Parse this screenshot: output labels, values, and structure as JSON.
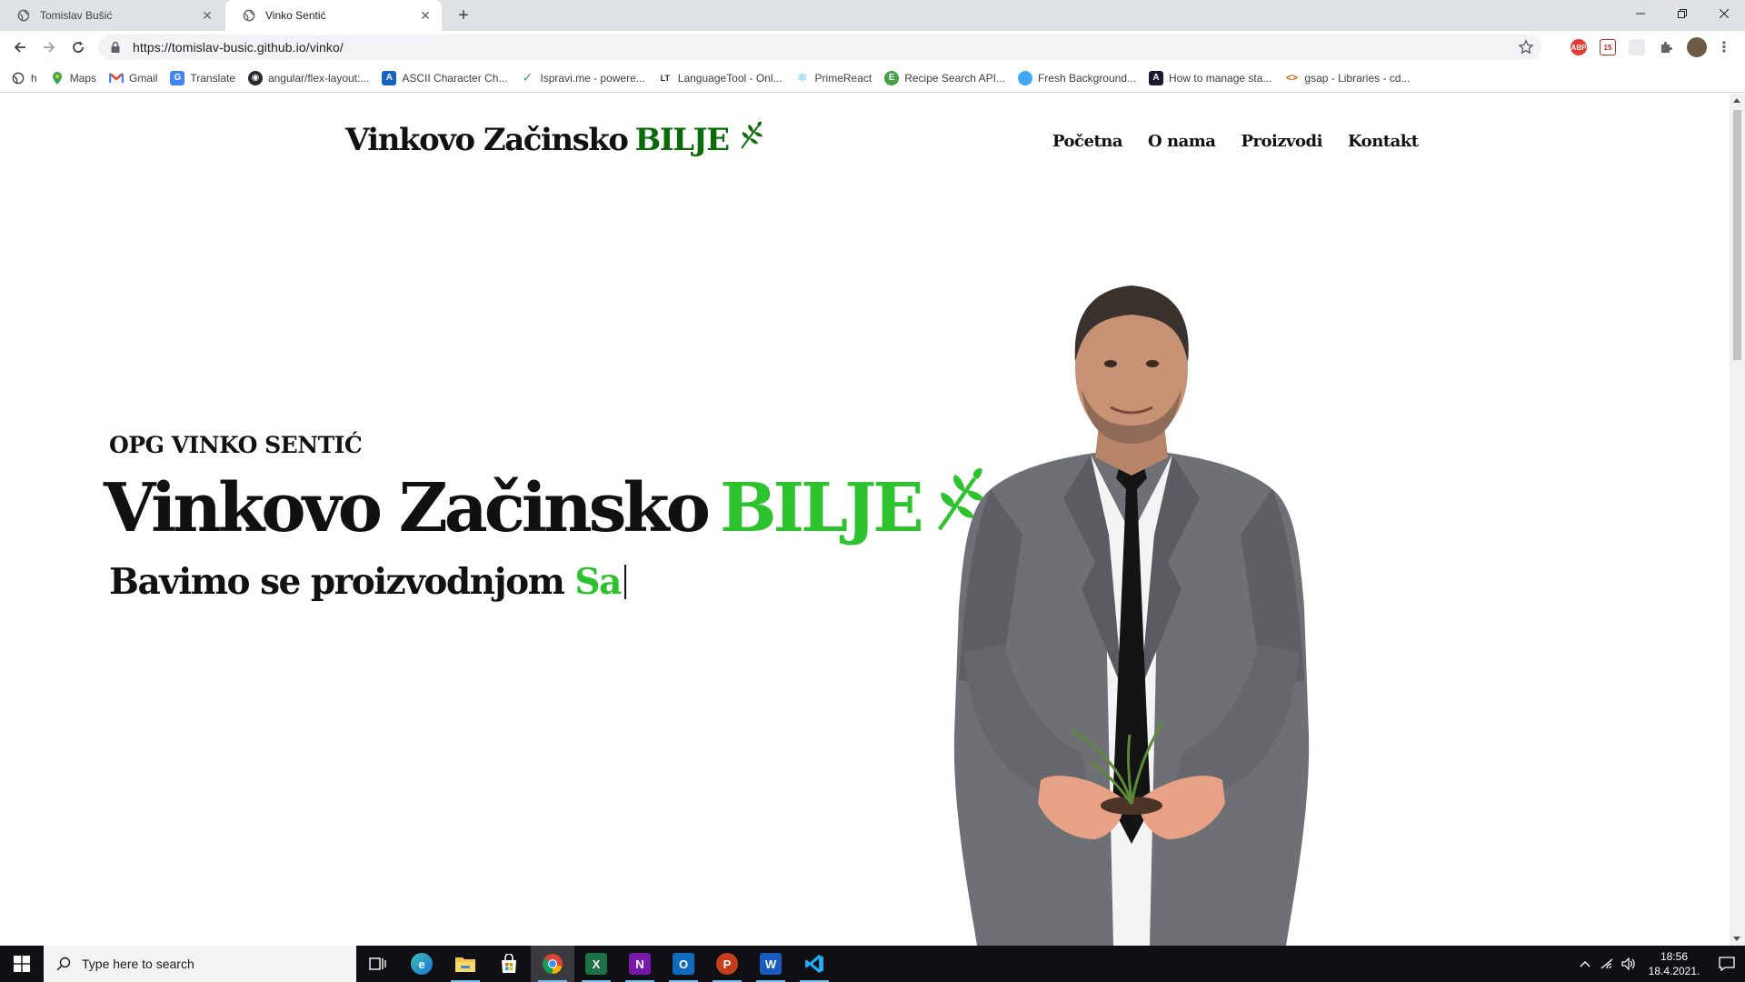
{
  "browser": {
    "tabs": [
      {
        "title": "Tomislav Bušić",
        "active": false
      },
      {
        "title": "Vinko Sentić",
        "active": true
      }
    ],
    "url": "https://tomislav-busic.github.io/vinko/",
    "bookmarks": [
      {
        "label": "h",
        "icon": "globe-icon"
      },
      {
        "label": "Maps",
        "icon": "maps-icon"
      },
      {
        "label": "Gmail",
        "icon": "gmail-icon"
      },
      {
        "label": "Translate",
        "icon": "translate-icon"
      },
      {
        "label": "angular/flex-layout:...",
        "icon": "github-icon"
      },
      {
        "label": "ASCII Character Ch...",
        "icon": "ascii-icon"
      },
      {
        "label": "Ispravi.me - powere...",
        "icon": "checkmark-icon"
      },
      {
        "label": "LanguageTool - Onl...",
        "icon": "languagetool-icon"
      },
      {
        "label": "PrimeReact",
        "icon": "primereact-icon"
      },
      {
        "label": "Recipe Search API...",
        "icon": "edamam-icon"
      },
      {
        "label": "Fresh Background...",
        "icon": "fresh-bg-icon"
      },
      {
        "label": "How to manage sta...",
        "icon": "angular-icon"
      },
      {
        "label": "gsap - Libraries - cd...",
        "icon": "code-icon"
      }
    ],
    "extensions": {
      "abp_label": "ABP",
      "calendar_label": "15"
    }
  },
  "site": {
    "logo": {
      "main": "Vinkovo Začinsko",
      "accent": "BILJE"
    },
    "nav": [
      "Početna",
      "O nama",
      "Proizvodi",
      "Kontakt"
    ],
    "hero": {
      "eyebrow": "OPG VINKO SENTIĆ",
      "title_main": "Vinkovo Začinsko",
      "title_accent": "BILJE",
      "subtitle_main": "Bavimo se proizvodnjom",
      "subtitle_typed": "Sa"
    }
  },
  "colors": {
    "accent_green": "#2ec22e",
    "logo_green": "#0b6b0b",
    "text_dark": "#111111"
  },
  "taskbar": {
    "search_placeholder": "Type here to search",
    "apps": [
      "task-view",
      "edge",
      "file-explorer",
      "store",
      "chrome",
      "excel",
      "onenote",
      "outlook",
      "powerpoint",
      "word",
      "vscode"
    ],
    "time": "18:56",
    "date": "18.4.2021."
  }
}
